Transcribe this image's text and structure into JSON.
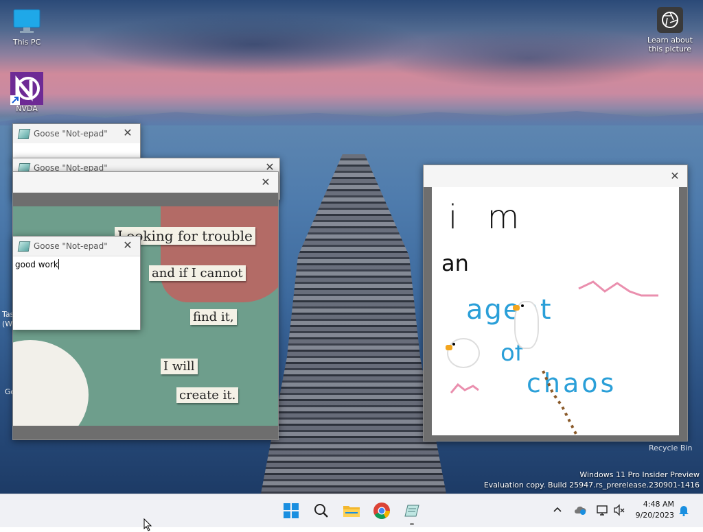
{
  "desktop": {
    "icons": [
      {
        "label": "This PC"
      },
      {
        "label": "NVDA"
      }
    ],
    "learn_about": {
      "line1": "Learn about",
      "line2": "this picture"
    },
    "recycle_bin": "Recycle Bin",
    "partial_labels": {
      "tas": "Tas",
      "w": "(W",
      "go": "Go"
    },
    "watermark": {
      "line1": "Windows 11 Pro Insider Preview",
      "line2": "Evaluation copy. Build 25947.rs_prerelease.230901-1416"
    }
  },
  "windows": {
    "notepad_title": "Goose \"Not-epad\"",
    "notepad_text": "good work",
    "close_glyph": "✕"
  },
  "meme": {
    "lines": [
      "Looking for trouble",
      "and if I cannot",
      "find it,",
      "I will",
      "create it."
    ]
  },
  "drawing": {
    "words": [
      "i m",
      "an",
      "agent",
      "of",
      "chaos"
    ],
    "colors": {
      "black": "#111111",
      "blue": "#2a9fd8",
      "pink": "#ea8fae"
    }
  },
  "taskbar": {
    "apps": [
      "start-icon",
      "search-icon",
      "file-explorer-icon",
      "chrome-icon",
      "goose-notepad-icon"
    ],
    "clock": {
      "time": "4:48 AM",
      "date": "9/20/2023"
    }
  }
}
